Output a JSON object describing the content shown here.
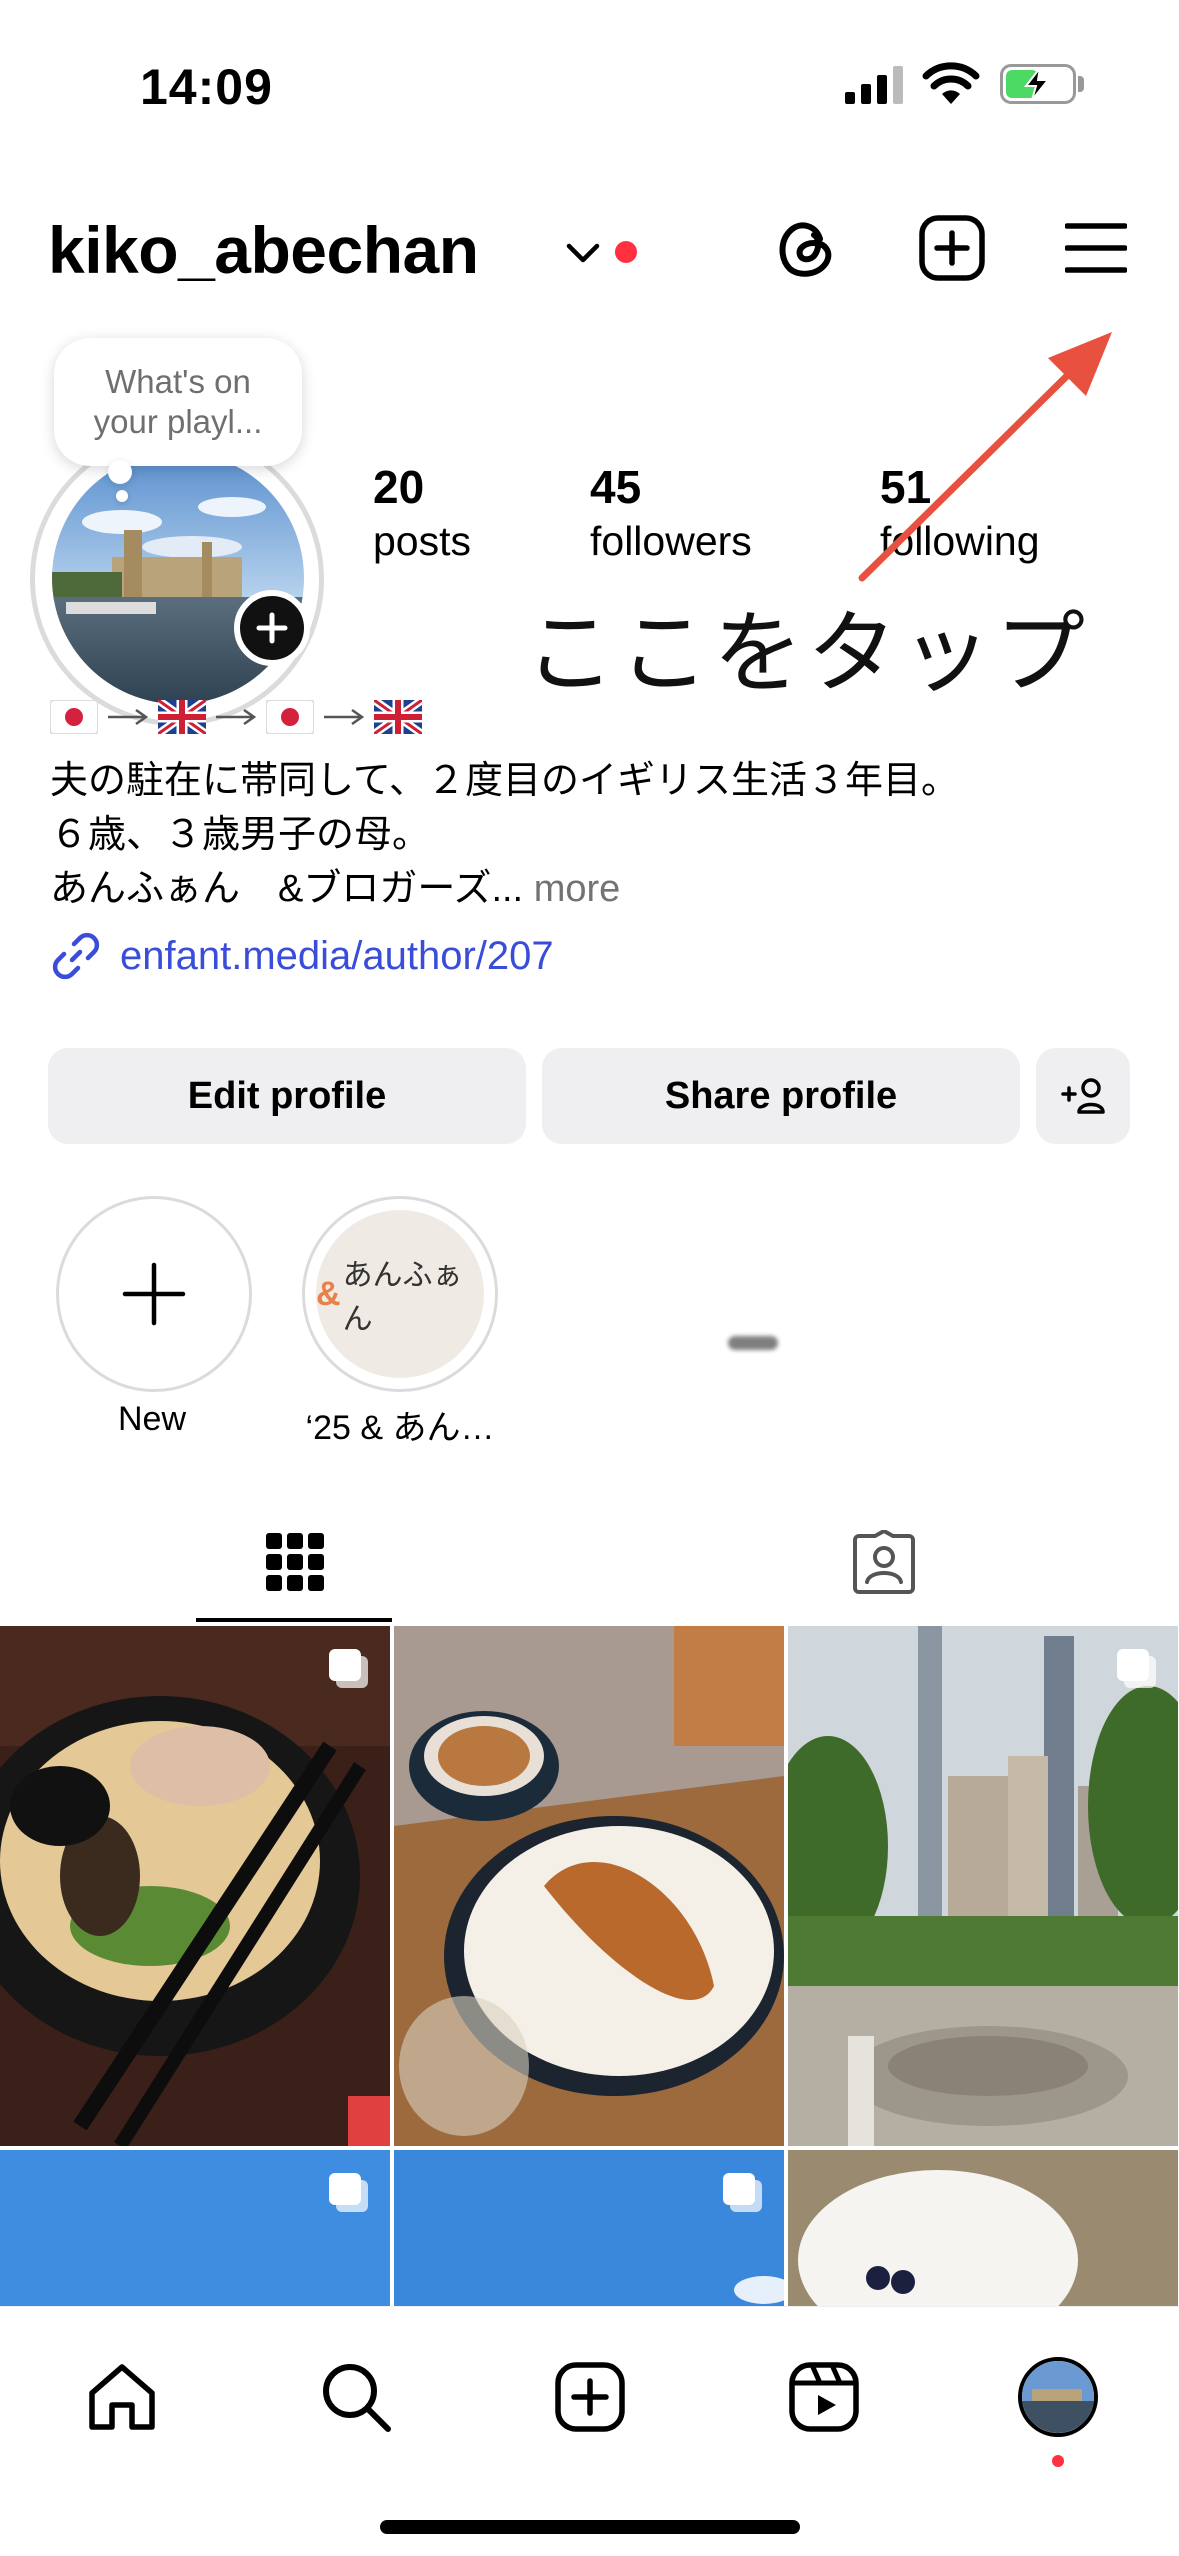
{
  "status_bar": {
    "time": "14:09"
  },
  "header": {
    "username": "kiko_abechan"
  },
  "profile": {
    "note": "What's on your playl...",
    "note_lines": [
      "What's on",
      "your playl..."
    ],
    "stats": [
      {
        "value": "20",
        "label": "posts"
      },
      {
        "value": "45",
        "label": "followers"
      },
      {
        "value": "51",
        "label": "following"
      }
    ]
  },
  "annotation": {
    "text": "ここをタップ"
  },
  "bio": {
    "flags": [
      "🇯🇵",
      "→",
      "🇬🇧",
      "→",
      "🇯🇵",
      "→",
      "🇬🇧"
    ],
    "line1": "夫の駐在に帯同して、２度目のイギリス生活３年目。",
    "line2": "６歳、３歳男子の母。",
    "line3": "あんふぁん　&ブロガーズ...",
    "more": "more",
    "link": "enfant.media/author/207"
  },
  "buttons": {
    "edit": "Edit profile",
    "share": "Share profile"
  },
  "highlights": [
    {
      "label": "New"
    },
    {
      "label": "‘25 & あん…",
      "cover_text": "あんふぁん",
      "cover_mark": "&"
    }
  ],
  "colors": {
    "accent_link": "#3a4dd9",
    "notification_red": "#ff3040",
    "battery_green": "#4cd964"
  },
  "icons": {
    "header": [
      "chevron-down-icon",
      "threads-icon",
      "create-plus-icon",
      "menu-icon"
    ],
    "tabs": [
      "grid-icon",
      "tagged-icon"
    ],
    "nav": [
      "home-icon",
      "search-icon",
      "create-icon",
      "reels-icon",
      "profile-avatar"
    ]
  }
}
